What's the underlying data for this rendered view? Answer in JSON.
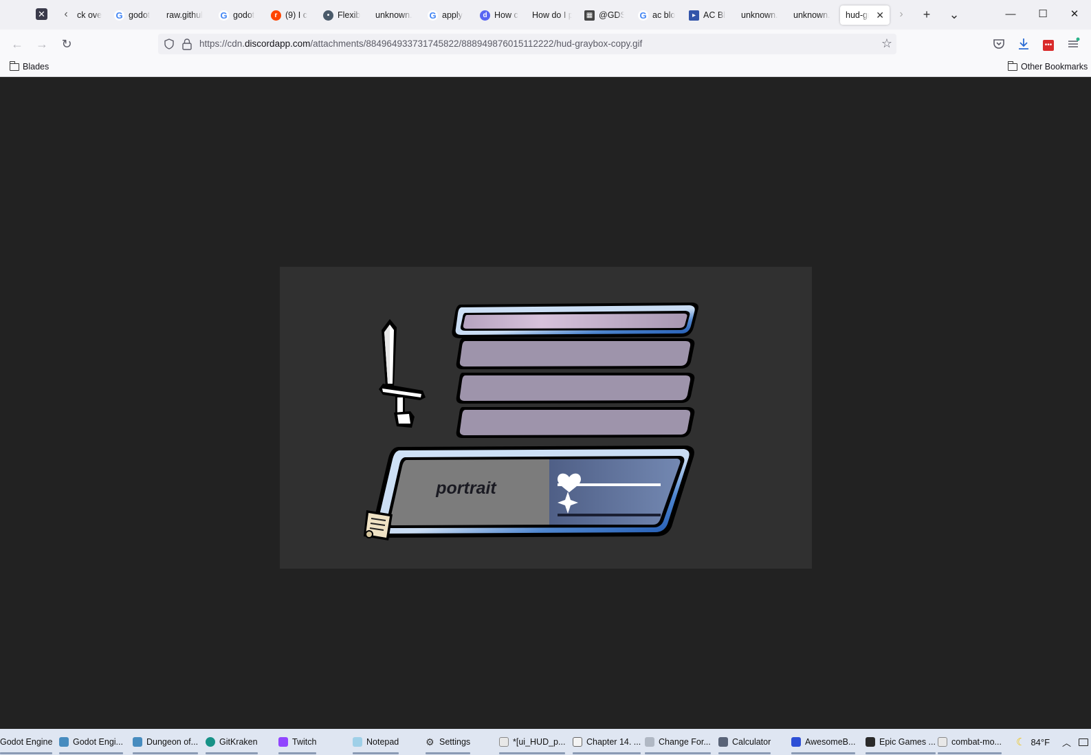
{
  "tabs": [
    {
      "label": "ck ove",
      "favicon": "none"
    },
    {
      "label": "godot",
      "favicon": "google"
    },
    {
      "label": "raw.githul",
      "favicon": "none"
    },
    {
      "label": "godot",
      "favicon": "google"
    },
    {
      "label": "(9) I c",
      "favicon": "reddit"
    },
    {
      "label": "Flexib",
      "favicon": "ghost"
    },
    {
      "label": "unknown.",
      "favicon": "none"
    },
    {
      "label": "apply",
      "favicon": "google"
    },
    {
      "label": "How c",
      "favicon": "discord"
    },
    {
      "label": "How do I p",
      "favicon": "none"
    },
    {
      "label": "@GDS",
      "favicon": "gds"
    },
    {
      "label": "ac blo",
      "favicon": "google"
    },
    {
      "label": "AC Bl",
      "favicon": "ac"
    },
    {
      "label": "unknown.",
      "favicon": "none"
    },
    {
      "label": "unknown.",
      "favicon": "none"
    }
  ],
  "active_tab": {
    "label": "hud-gra",
    "close": "✕"
  },
  "window_controls": {
    "minimize": "—",
    "maximize": "☐",
    "close": "✕",
    "new_tab": "+",
    "tab_list": "⌄"
  },
  "nav": {
    "back": "←",
    "forward": "→",
    "reload": "↻",
    "url_prefix": "https://cdn.",
    "url_host": "discordapp.com",
    "url_path": "/attachments/884964933731745822/888949876015112222/hud-graybox-copy.gif",
    "star": "☆"
  },
  "bookmarks": {
    "left": "Blades",
    "right": "Other Bookmarks"
  },
  "hud": {
    "portrait_label": "portrait",
    "health_level": 1.0,
    "mana_level": 1.0,
    "icons": [
      "sword-icon",
      "heart-icon",
      "sparkle-icon",
      "scroll-icon"
    ],
    "colors": {
      "bar_fill": "#9e94ab",
      "bar_top_fill": "#c9b8d2",
      "frame_blue": "#2f6bc1",
      "portrait_bg": "#7c7c7c",
      "stats_bg": "#5a6a93"
    }
  },
  "taskbar": {
    "items": [
      {
        "label": "Godot Engine",
        "icon": "godot-icon"
      },
      {
        "label": "Godot Engi...",
        "icon": "godot-icon"
      },
      {
        "label": "Dungeon of...",
        "icon": "godot-icon"
      },
      {
        "label": "GitKraken",
        "icon": "gitkraken-icon"
      },
      {
        "label": "Twitch",
        "icon": "twitch-icon"
      },
      {
        "label": "Notepad",
        "icon": "notepad-icon"
      },
      {
        "label": "Settings",
        "icon": "gear-icon"
      },
      {
        "label": "*[ui_HUD_p...",
        "icon": "paint-icon"
      },
      {
        "label": "Chapter 14. ...",
        "icon": "document-icon"
      },
      {
        "label": "Change For...",
        "icon": "ship-icon"
      },
      {
        "label": "Calculator",
        "icon": "calculator-icon"
      },
      {
        "label": "AwesomeB...",
        "icon": "app-icon"
      },
      {
        "label": "Epic Games ...",
        "icon": "epic-icon"
      },
      {
        "label": "combat-mo...",
        "icon": "paint-icon"
      }
    ],
    "weather": "84°F"
  }
}
